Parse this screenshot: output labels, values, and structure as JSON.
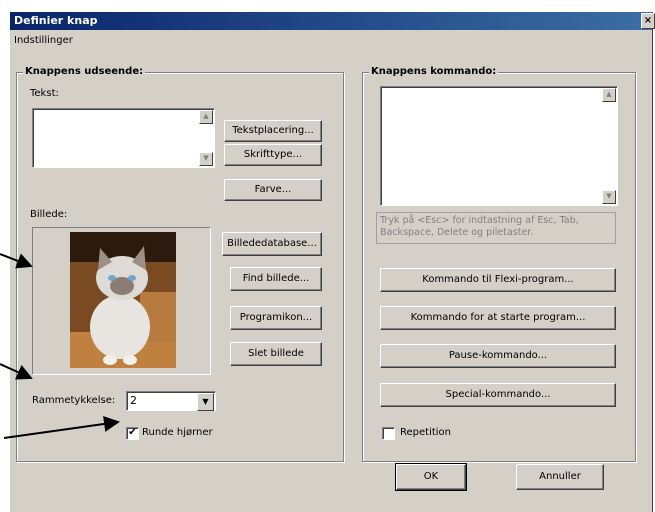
{
  "window": {
    "title": "Definier knap",
    "close_glyph": "×"
  },
  "menu": {
    "label": "Indstillinger"
  },
  "appearance": {
    "legend": "Knappens udseende:",
    "text_label": "Tekst:",
    "text_value": "",
    "buttons": {
      "text_placement": "Tekstplacering...",
      "font": "Skrifttype...",
      "color": "Farve...",
      "image_db": "Billededatabase...",
      "find_image": "Find billede...",
      "program_icon": "Programikon...",
      "delete_image": "Slet billede"
    },
    "image_label": "Billede:",
    "frame_label": "Rammetykkelse:",
    "frame_value": "2",
    "rounded_label": "Runde hjørner",
    "rounded_checked": true
  },
  "command": {
    "legend": "Knappens kommando:",
    "value": "",
    "hint": "Tryk på <Esc> for indtastning af Esc, Tab, Backspace, Delete og piletaster.",
    "buttons": {
      "flexi": "Kommando til Flexi-program...",
      "start_program": "Kommando for at starte program...",
      "pause": "Pause-kommando...",
      "special": "Special-kommando..."
    },
    "repetition_label": "Repetition",
    "repetition_checked": false
  },
  "footer": {
    "ok": "OK",
    "cancel": "Annuller"
  }
}
